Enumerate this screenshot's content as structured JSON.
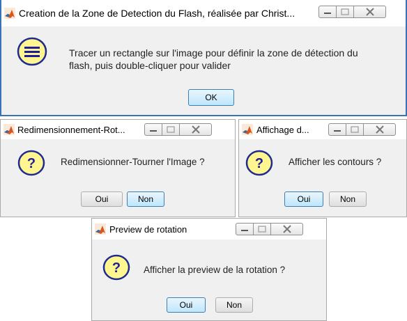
{
  "colors": {
    "icon_yellow": "#fff68f",
    "icon_border": "#1f2a8f",
    "icon_mark": "#1e1e9c",
    "default_button_border": "#3c7fb1",
    "frame_blue": "#3a72b8"
  },
  "dialogs": {
    "zone": {
      "title": "Creation de la Zone de Detection du Flash, réalisée par Christ...",
      "icon": "help-lines-icon",
      "message_line1": "Tracer un rectangle sur l'image pour définir la zone de détection du",
      "message_line2": "flash, puis double-cliquer pour valider",
      "ok_label": "OK"
    },
    "resize": {
      "title": "Redimensionnement-Rot...",
      "icon": "question-icon",
      "message": "Redimensionner-Tourner l'Image ?",
      "yes_label": "Oui",
      "no_label": "Non"
    },
    "contours": {
      "title": "Affichage d...",
      "icon": "question-icon",
      "message": "Afficher les contours ?",
      "yes_label": "Oui",
      "no_label": "Non"
    },
    "preview": {
      "title": "Preview de rotation",
      "icon": "question-icon",
      "message": "Afficher la preview de la rotation ?",
      "yes_label": "Oui",
      "no_label": "Non"
    }
  }
}
